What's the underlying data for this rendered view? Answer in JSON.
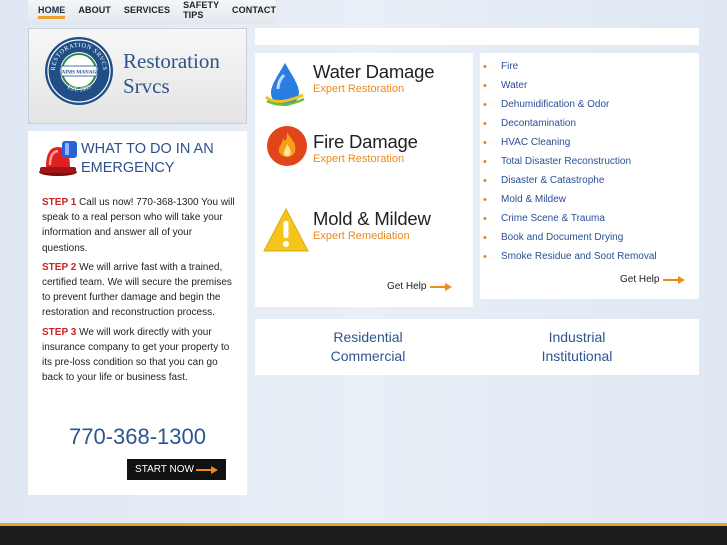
{
  "nav": {
    "items": [
      "HOME",
      "ABOUT",
      "SERVICES",
      "SAFETY TIPS",
      "CONTACT"
    ]
  },
  "logo": {
    "seal_top": "RESTORATION SRVCS",
    "seal_mid": "CLAIMS MANAGER",
    "seal_bottom": "EST. 1995",
    "brand_line1": "Restoration",
    "brand_line2": "Srvcs"
  },
  "emergency": {
    "title": "WHAT TO DO IN AN EMERGENCY",
    "steps": [
      {
        "label": "STEP 1",
        "text": "Call us now! 770-368-1300 You will speak to a real person who will take your information and answer all of your questions."
      },
      {
        "label": "STEP 2",
        "text": "We will arrive fast with a trained, certified team. We will secure the premises to prevent further damage and begin the restoration and reconstruction process."
      },
      {
        "label": "STEP 3",
        "text": "We will work directly with your insurance company to get your property to its pre-loss condition so that you can go back to your life or business fast."
      }
    ],
    "phone": "770-368-1300",
    "start_label": "START NOW"
  },
  "services": [
    {
      "title": "Water Damage",
      "subtitle": "Expert Restoration",
      "icon": "water-drop-icon"
    },
    {
      "title": "Fire Damage",
      "subtitle": "Expert Restoration",
      "icon": "flame-icon"
    },
    {
      "title": "Mold & Mildew",
      "subtitle": "Expert Remediation",
      "icon": "warning-icon"
    }
  ],
  "get_help_label": "Get Help",
  "service_list": [
    "Fire",
    "Water",
    "Dehumidification & Odor",
    "Decontamination",
    "HVAC Cleaning",
    "Total Disaster Reconstruction",
    "Disaster & Catastrophe",
    "Mold & Mildew",
    "Crime Scene & Trauma",
    "Book and Document Drying",
    "Smoke Residue and Soot Removal"
  ],
  "markets": {
    "left": [
      "Residential",
      "Commercial"
    ],
    "right": [
      "Industrial",
      "Institutional"
    ]
  },
  "colors": {
    "accent_orange": "#ec8a1c",
    "link_blue": "#2a4f96",
    "step_red": "#cc2222"
  }
}
